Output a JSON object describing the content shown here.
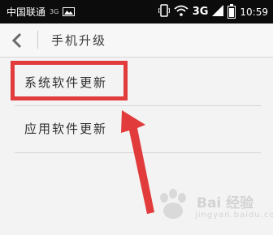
{
  "status_bar": {
    "carrier": "中国联通",
    "network_small": "3G",
    "network_big": "3G",
    "time": "10:59"
  },
  "title_bar": {
    "title": "手机升级"
  },
  "menu": {
    "items": [
      {
        "label": "系统软件更新"
      },
      {
        "label": "应用软件更新"
      }
    ]
  },
  "annotation": {
    "highlight_color": "#e23b3b"
  },
  "watermark": {
    "text": "Bai 经验",
    "url": "jingyan.baidu.com"
  }
}
